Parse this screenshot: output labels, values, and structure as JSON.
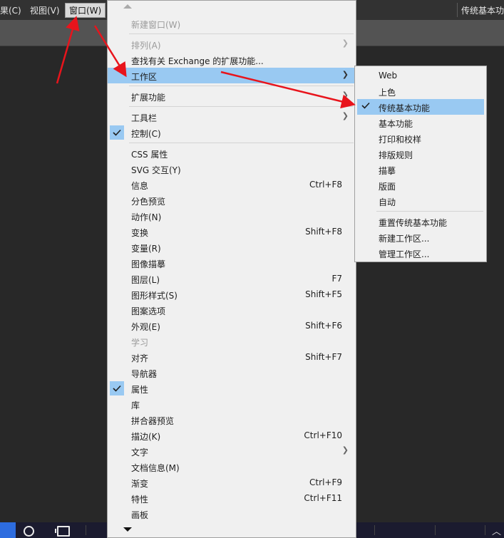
{
  "menubar": {
    "items": [
      "果(C)",
      "视图(V)",
      "窗口(W)"
    ],
    "right_text": "传统基本功"
  },
  "menu": {
    "items": [
      {
        "label": "新建窗口(W)",
        "disabled": true
      },
      {
        "label": "排列(A)",
        "disabled": true,
        "submenu": true
      },
      {
        "label": "查找有关 Exchange 的扩展功能..."
      },
      {
        "label": "工作区",
        "submenu": true,
        "highlighted": true
      },
      {
        "label": "扩展功能",
        "submenu": true
      },
      {
        "label": "工具栏",
        "submenu": true
      },
      {
        "label": "控制(C)",
        "checked": true
      },
      {
        "label": "CSS 属性"
      },
      {
        "label": "SVG 交互(Y)"
      },
      {
        "label": "信息",
        "shortcut": "Ctrl+F8"
      },
      {
        "label": "分色预览"
      },
      {
        "label": "动作(N)"
      },
      {
        "label": "变换",
        "shortcut": "Shift+F8"
      },
      {
        "label": "变量(R)"
      },
      {
        "label": "图像描摹"
      },
      {
        "label": "图层(L)",
        "shortcut": "F7"
      },
      {
        "label": "图形样式(S)",
        "shortcut": "Shift+F5"
      },
      {
        "label": "图案选项"
      },
      {
        "label": "外观(E)",
        "shortcut": "Shift+F6"
      },
      {
        "label": "学习",
        "disabled": true
      },
      {
        "label": "对齐",
        "shortcut": "Shift+F7"
      },
      {
        "label": "导航器"
      },
      {
        "label": "属性",
        "checked": true
      },
      {
        "label": "库"
      },
      {
        "label": "拼合器预览"
      },
      {
        "label": "描边(K)",
        "shortcut": "Ctrl+F10"
      },
      {
        "label": "文字",
        "submenu": true
      },
      {
        "label": "文档信息(M)"
      },
      {
        "label": "渐变",
        "shortcut": "Ctrl+F9"
      },
      {
        "label": "特性",
        "shortcut": "Ctrl+F11"
      },
      {
        "label": "画板"
      }
    ]
  },
  "submenu": {
    "items": [
      {
        "label": "Web"
      },
      {
        "label": "上色"
      },
      {
        "label": "传统基本功能",
        "checked": true,
        "highlighted": true
      },
      {
        "label": "基本功能"
      },
      {
        "label": "打印和校样"
      },
      {
        "label": "排版规则"
      },
      {
        "label": "描摹"
      },
      {
        "label": "版面"
      },
      {
        "label": "自动"
      },
      {
        "label": "重置传统基本功能"
      },
      {
        "label": "新建工作区..."
      },
      {
        "label": "管理工作区..."
      }
    ]
  },
  "colors": {
    "highlight": "#99c9f2",
    "menu_bg": "#f0f0f0",
    "annotation_arrow": "#e8141c"
  },
  "icons": {
    "check": "check-icon",
    "submenu": "chevron-right-icon",
    "scroll_up": "scroll-up-arrow-icon",
    "scroll_down": "scroll-down-arrow-icon"
  }
}
